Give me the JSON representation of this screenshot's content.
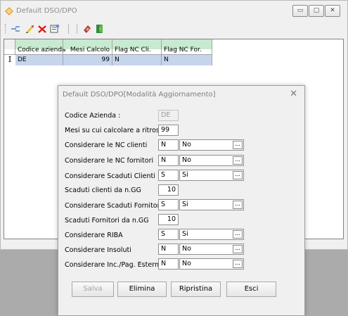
{
  "window": {
    "title": "Default DSO/DPO",
    "controls": {
      "minimize": "▭",
      "maximize": "▢",
      "close": "✕"
    }
  },
  "toolbar": {
    "icons": [
      "add-icon",
      "edit-icon",
      "delete-icon",
      "properties-icon",
      "refresh-icon",
      "exit-icon"
    ]
  },
  "grid": {
    "columns": [
      "Codice azienda",
      "Mesi Calcolo",
      "Flag NC Cli.",
      "Flag NC For."
    ],
    "row_indicator": "I",
    "rows": [
      {
        "codice": "DE",
        "mesi": "99",
        "nc_cli": "N",
        "nc_for": "N"
      }
    ]
  },
  "dialog": {
    "title": "Default DSO/DPO[Modalità Aggiornamento]",
    "close_glyph": "✕",
    "fields": {
      "codice_azienda": {
        "label": "Codice Azienda :",
        "value": "DE"
      },
      "mesi": {
        "label": "Mesi su cui calcolare a ritroso",
        "value": "99"
      },
      "nc_clienti": {
        "label": "Considerare le NC clienti",
        "code": "N",
        "desc": "No"
      },
      "nc_fornitori": {
        "label": "Considerare le NC fornitori",
        "code": "N",
        "desc": "No"
      },
      "scaduti_clienti": {
        "label": "Considerare Scaduti Clienti",
        "code": "S",
        "desc": "Si"
      },
      "scaduti_clienti_gg": {
        "label": "Scaduti clienti da n.GG",
        "value": "10"
      },
      "scaduti_fornitori": {
        "label": "Considerare Scaduti Fornitori",
        "code": "S",
        "desc": "Si"
      },
      "scaduti_fornitori_gg": {
        "label": "Scaduti Fornitori da n.GG",
        "value": "10"
      },
      "riba": {
        "label": "Considerare RIBA",
        "code": "S",
        "desc": "Si"
      },
      "insoluti": {
        "label": "Considerare Insoluti",
        "code": "N",
        "desc": "No"
      },
      "inc_pag_esterni": {
        "label": "Considerare Inc./Pag. Esterni",
        "code": "N",
        "desc": "No"
      }
    },
    "lookup_glyph": "...",
    "buttons": {
      "salva": "Salva",
      "elimina": "Elimina",
      "ripristina": "Ripristina",
      "esci": "Esci"
    }
  },
  "colors": {
    "grid_header_band": "#c8ead0",
    "selected_row": "#c5d5ec",
    "window_bg": "#f0f0f0",
    "desktop_bg": "#ababab"
  }
}
